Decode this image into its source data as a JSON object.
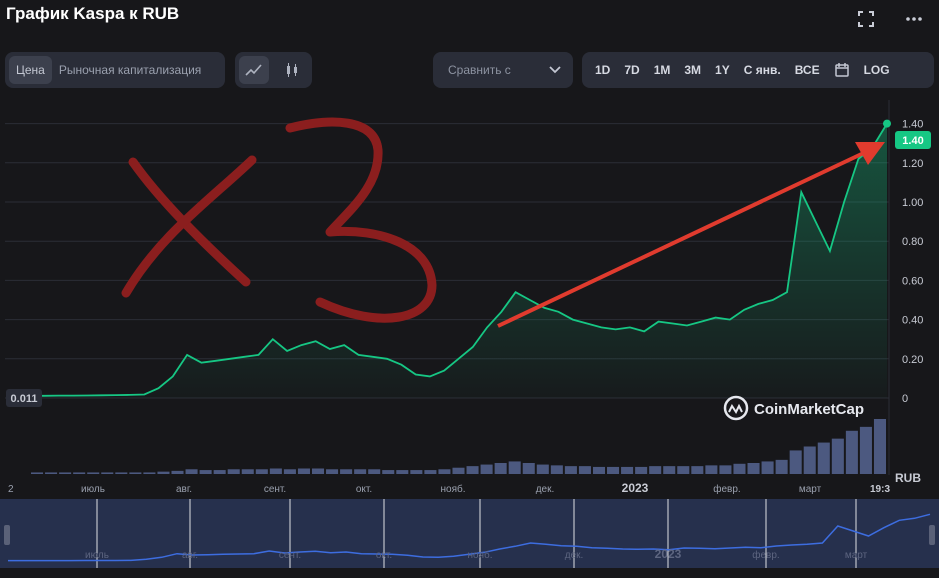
{
  "header": {
    "title": "График Kaspa к RUB"
  },
  "toolbar": {
    "metric_tabs": [
      {
        "label": "Цена",
        "active": true
      },
      {
        "label": "Рыночная капитализация",
        "active": false
      }
    ],
    "compare_placeholder": "Сравнить с",
    "ranges": [
      "1D",
      "7D",
      "1M",
      "3M",
      "1Y",
      "С янв.",
      "ВСЕ"
    ],
    "log_label": "LOG"
  },
  "colors": {
    "line": "#16c784",
    "badge": "#16c784",
    "annotation": "#8b1e1e",
    "arrow": "#e03b2e",
    "volume": "#5a6a9a"
  },
  "chart_data": {
    "type": "area",
    "title": "График Kaspa к RUB",
    "currency_label": "RUB",
    "ylim": [
      0,
      1.5
    ],
    "y_ticks": [
      "0",
      "0.20",
      "0.40",
      "0.60",
      "0.80",
      "1.00",
      "1.20",
      "1.40"
    ],
    "x_ticks": [
      "2",
      "июль",
      "авг.",
      "сент.",
      "окт.",
      "нояб.",
      "дек.",
      "2023",
      "февр.",
      "март",
      "19:3"
    ],
    "x": [
      0,
      5,
      10,
      15,
      20,
      25,
      30,
      35,
      40,
      45,
      50,
      55,
      60,
      65,
      70,
      75,
      80,
      85,
      90,
      95,
      100,
      105,
      110,
      115,
      120,
      125,
      130,
      135,
      140,
      145,
      150,
      155,
      160,
      165,
      170,
      175,
      180,
      185,
      190,
      195,
      200,
      205,
      210,
      215,
      220,
      225,
      230,
      235,
      240,
      245,
      250,
      255,
      260,
      265,
      270,
      275,
      280,
      285,
      290,
      295,
      300
    ],
    "values": [
      0.011,
      0.011,
      0.012,
      0.012,
      0.013,
      0.014,
      0.015,
      0.016,
      0.018,
      0.05,
      0.11,
      0.22,
      0.18,
      0.19,
      0.2,
      0.21,
      0.22,
      0.3,
      0.24,
      0.27,
      0.29,
      0.25,
      0.27,
      0.22,
      0.21,
      0.2,
      0.17,
      0.12,
      0.11,
      0.14,
      0.2,
      0.26,
      0.36,
      0.44,
      0.54,
      0.5,
      0.46,
      0.44,
      0.4,
      0.38,
      0.36,
      0.35,
      0.36,
      0.34,
      0.39,
      0.38,
      0.37,
      0.39,
      0.41,
      0.4,
      0.45,
      0.48,
      0.5,
      0.54,
      1.05,
      0.9,
      0.75,
      1.0,
      1.22,
      1.28,
      1.4
    ],
    "current_value": "1.40",
    "start_value": "0.011",
    "volume": [
      2,
      2,
      2,
      2,
      2,
      2,
      2,
      2,
      2,
      3,
      4,
      6,
      5,
      5,
      6,
      6,
      6,
      7,
      6,
      7,
      7,
      6,
      6,
      6,
      6,
      5,
      5,
      5,
      5,
      6,
      8,
      10,
      12,
      14,
      16,
      14,
      12,
      11,
      10,
      10,
      9,
      9,
      9,
      9,
      10,
      10,
      10,
      10,
      11,
      11,
      13,
      14,
      16,
      18,
      30,
      35,
      40,
      45,
      55,
      60,
      70
    ],
    "legend": "none",
    "grid": true
  },
  "annotations": {
    "handwritten_text": "x3",
    "arrow": "red-arrow"
  },
  "watermark": {
    "brand": "CoinMarketCap"
  },
  "navigator": {
    "labels": [
      "июль",
      "авг.",
      "сент.",
      "окт.",
      "нояб.",
      "дек.",
      "2023",
      "февр.",
      "март"
    ]
  }
}
